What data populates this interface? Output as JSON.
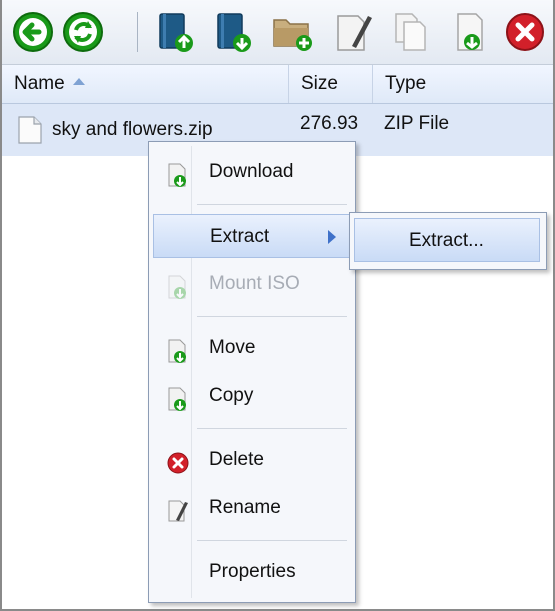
{
  "toolbar": {
    "buttons": [
      {
        "name": "back-icon",
        "color": "#1a9a1a"
      },
      {
        "name": "refresh-icon",
        "color": "#1a9a1a"
      },
      {
        "name": "upload-icon",
        "color": "#1e5a86"
      },
      {
        "name": "download-icon",
        "color": "#1e5a86"
      },
      {
        "name": "new-folder-icon",
        "color": "#b89a66"
      },
      {
        "name": "rename-icon",
        "color": "#444"
      },
      {
        "name": "copy-icon",
        "color": "#9aa"
      },
      {
        "name": "new-file-icon",
        "color": "#1a9a1a"
      },
      {
        "name": "delete-icon",
        "color": "#d2202a"
      }
    ]
  },
  "table": {
    "columns": [
      "Name",
      "Size",
      "Type"
    ],
    "rows": [
      {
        "name": "sky and flowers.zip",
        "size": "276.93",
        "type": "ZIP File"
      }
    ]
  },
  "context_menu": {
    "items": [
      {
        "label": "Download",
        "enabled": true,
        "icon": "download-icon"
      },
      {
        "label": "Extract",
        "enabled": true,
        "has_submenu": true
      },
      {
        "label": "Mount ISO",
        "enabled": false,
        "icon": "mount-iso-icon"
      },
      {
        "label": "Move",
        "enabled": true,
        "icon": "move-icon"
      },
      {
        "label": "Copy",
        "enabled": true,
        "icon": "copy-icon"
      },
      {
        "label": "Delete",
        "enabled": true,
        "icon": "delete-icon"
      },
      {
        "label": "Rename",
        "enabled": true,
        "icon": "rename-icon"
      },
      {
        "label": "Properties",
        "enabled": true
      }
    ]
  },
  "submenu": {
    "items": [
      {
        "label": "Extract..."
      }
    ]
  },
  "colors": {
    "selection": "#dde7f7",
    "accent": "#3f71c9",
    "disabled_text": "#a7acb5"
  }
}
